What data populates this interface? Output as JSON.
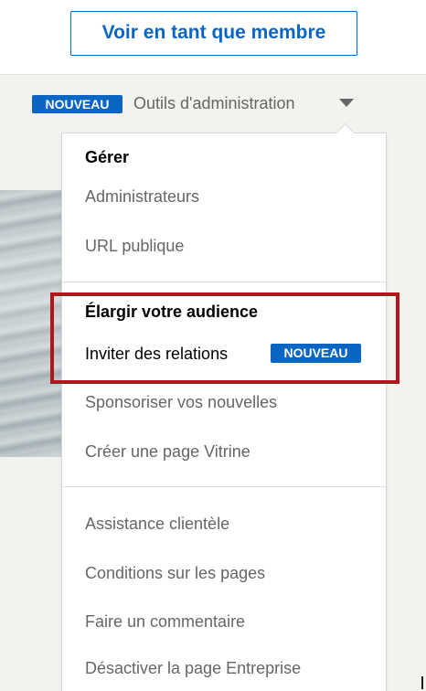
{
  "header": {
    "view_as_member_label": "Voir en tant que membre"
  },
  "toolbar": {
    "new_badge": "NOUVEAU",
    "admin_tools_label": "Outils d'administration",
    "caret_icon": "caret-down-icon"
  },
  "menu": {
    "sections": [
      {
        "heading": "Gérer",
        "items": [
          {
            "label": "Administrateurs"
          },
          {
            "label": "URL publique"
          }
        ]
      },
      {
        "heading": "Élargir votre audience",
        "items": [
          {
            "label": "Inviter des relations",
            "badge": "NOUVEAU"
          },
          {
            "label": "Sponsoriser vos nouvelles"
          },
          {
            "label": "Créer une page Vitrine"
          }
        ]
      },
      {
        "heading": "",
        "items": [
          {
            "label": "Assistance clientèle"
          },
          {
            "label": "Conditions sur les pages"
          },
          {
            "label": "Faire un commentaire"
          },
          {
            "label": "Désactiver la page Entreprise"
          }
        ]
      }
    ]
  },
  "colors": {
    "brand_blue": "#0a66c2",
    "highlight_red": "#b4141d",
    "page_background": "#f3f2ef"
  }
}
